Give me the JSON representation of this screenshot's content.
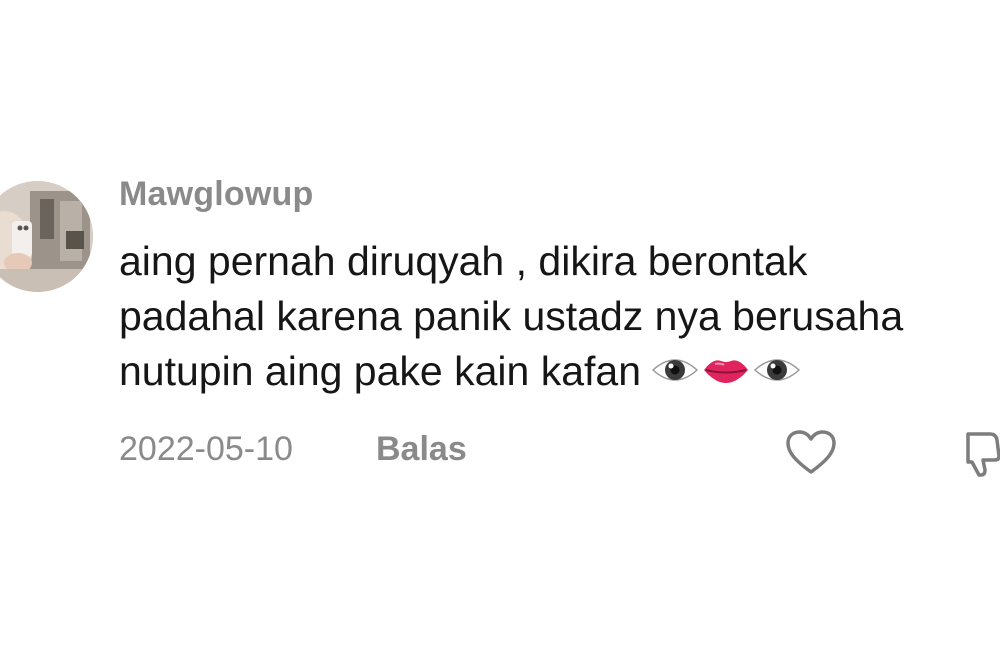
{
  "comment": {
    "username": "Mawglowup",
    "text_lines": [
      "aing pernah diruqyah , dikira berontak",
      "padahal karena panik ustadz nya berusaha",
      "nutupin aing pake kain kafan"
    ],
    "emojis": [
      "eye-emoji",
      "lips-emoji",
      "eye-emoji"
    ],
    "date": "2022-05-10",
    "reply_label": "Balas"
  },
  "icons": {
    "like": "heart-outline-icon",
    "dislike": "thumbs-down-outline-icon"
  },
  "colors": {
    "background": "#ffffff",
    "username": "#8a8a8a",
    "text": "#161616",
    "meta": "#8a8a8a"
  }
}
